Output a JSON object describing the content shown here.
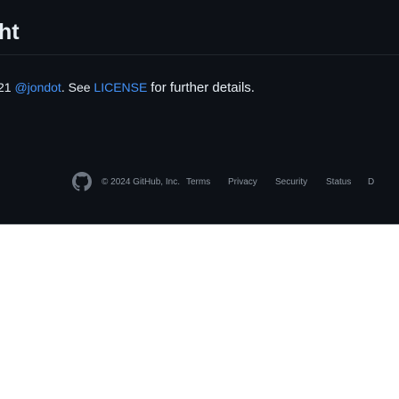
{
  "readme": {
    "heading": "ht",
    "copyright_prefix": "21",
    "author_link": "@jondot",
    "after_author": ". See",
    "license_link": "LICENSE",
    "suffix": "for further details."
  },
  "footer": {
    "copyright": "© 2024 GitHub, Inc.",
    "links": [
      "Terms",
      "Privacy",
      "Security",
      "Status",
      "D"
    ]
  },
  "colors": {
    "background_dark": "#0d1117",
    "text_primary": "#e6edf3",
    "link": "#4493f8",
    "text_muted": "#8d96a0"
  },
  "icons": {
    "footer_logo": "github-mark-icon"
  }
}
